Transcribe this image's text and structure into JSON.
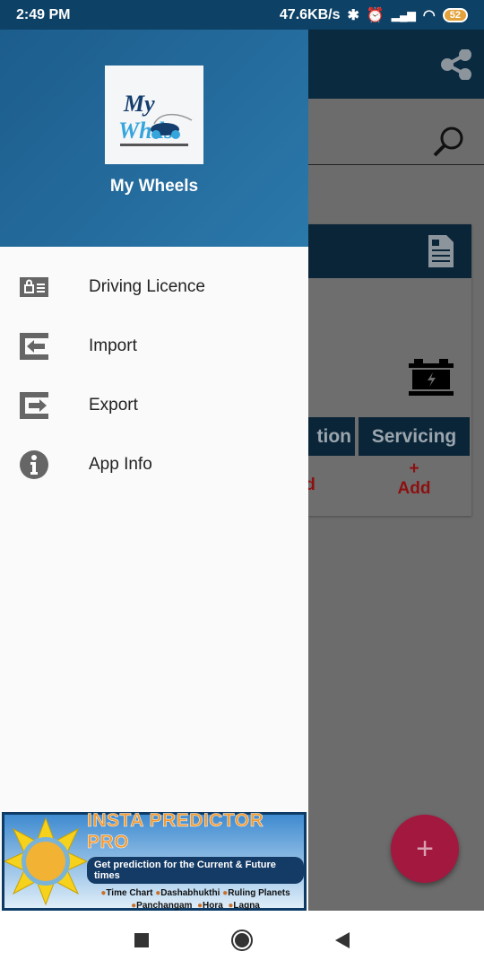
{
  "status_bar": {
    "time": "2:49 PM",
    "net_speed": "47.6KB/s",
    "battery": "52",
    "icons": [
      "bluetooth-icon",
      "vibrate-icon",
      "alarm-icon",
      "volte-icon",
      "signal-icon",
      "wifi-icon",
      "battery-icon"
    ]
  },
  "background_app": {
    "tabs": [
      "tion",
      "Servicing"
    ],
    "add_labels": [
      "d",
      "Add"
    ],
    "add_plus": "+",
    "fab": "+",
    "icons": [
      "share-icon",
      "search-icon",
      "document-icon",
      "car-battery-icon"
    ]
  },
  "drawer": {
    "title": "My Wheels",
    "logo_text": "My Wheels",
    "items": [
      {
        "label": "Driving Licence",
        "icon": "id-card-icon"
      },
      {
        "label": "Import",
        "icon": "import-icon"
      },
      {
        "label": "Export",
        "icon": "export-icon"
      },
      {
        "label": "App Info",
        "icon": "info-icon"
      }
    ]
  },
  "ad": {
    "title": "INSTA PREDICTOR PRO",
    "tagline": "Get prediction for the Current & Future times",
    "features_line1": [
      "Time Chart",
      "Dashabhukthi",
      "Ruling Planets"
    ],
    "features_line2": [
      "Panchangam",
      "Hora",
      "Lagna"
    ]
  },
  "colors": {
    "drawer_header": "#1c5d8c",
    "fab": "#a3183f",
    "add_text": "#8d1010"
  }
}
